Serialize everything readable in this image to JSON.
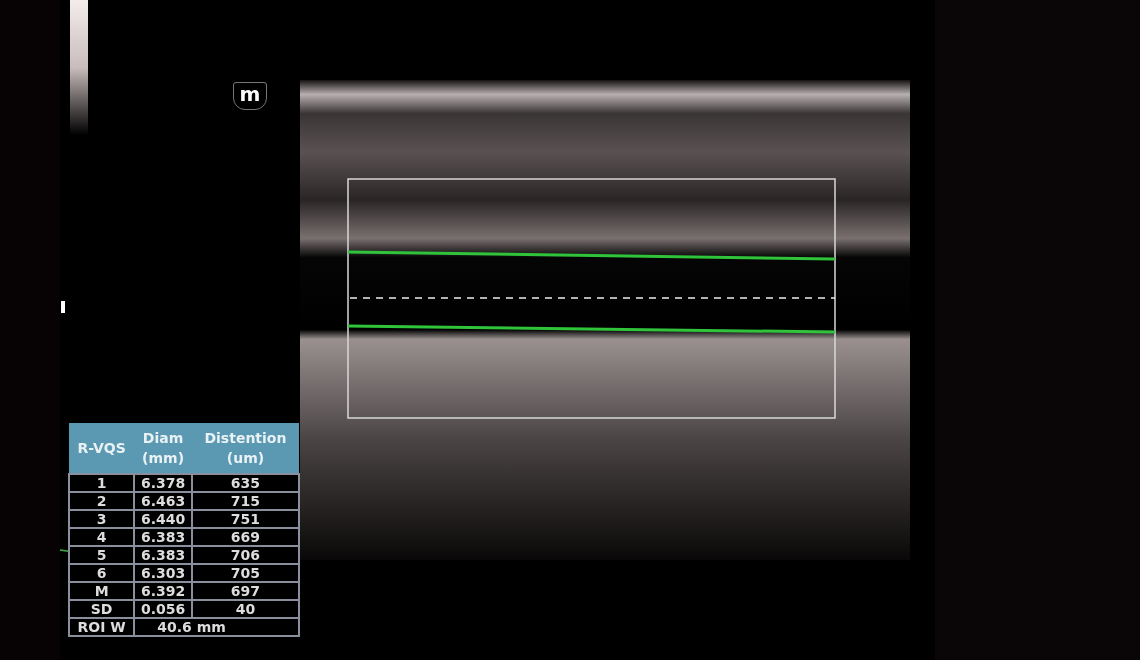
{
  "probe_marker": "m",
  "measurement_table": {
    "columns": [
      "R-VQS",
      "Diam\n(mm)",
      "Distention\n(um)"
    ],
    "rows": [
      [
        "1",
        "6.378",
        "635"
      ],
      [
        "2",
        "6.463",
        "715"
      ],
      [
        "3",
        "6.440",
        "751"
      ],
      [
        "4",
        "6.383",
        "669"
      ],
      [
        "5",
        "6.383",
        "706"
      ],
      [
        "6",
        "6.303",
        "705"
      ],
      [
        "M",
        "6.392",
        "697"
      ],
      [
        "SD",
        "0.056",
        "40"
      ]
    ],
    "footer": {
      "label": "ROI W",
      "value": "40.6 mm"
    }
  }
}
